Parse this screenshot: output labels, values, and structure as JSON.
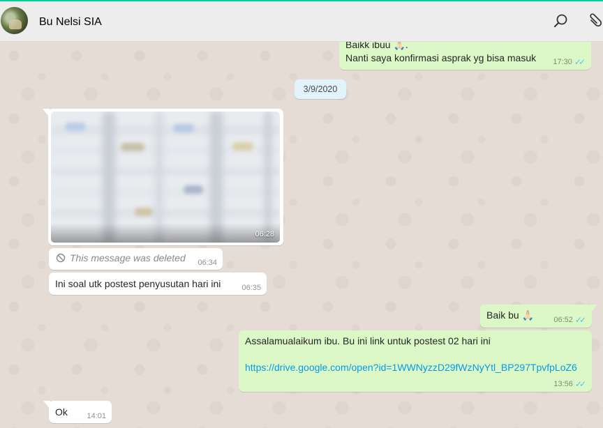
{
  "header": {
    "contact_name": "Bu Nelsi SIA",
    "icons": [
      "avatar",
      "search-icon",
      "paperclip-icon"
    ]
  },
  "colors": {
    "accent": "#06cf9c",
    "outgoing_bubble": "#dcf8c6",
    "incoming_bubble": "#ffffff",
    "date_chip": "#e1f3fb",
    "read_ticks": "#4fc3f7",
    "link": "#039be5",
    "chat_bg": "#e5ddd5"
  },
  "messages": {
    "m1": {
      "direction": "out",
      "line1": "Baikk ibuu 🙏🏻.",
      "line2": "Nanti saya konfirmasi asprak yg bisa masuk",
      "time": "17:30",
      "status": "read"
    },
    "date_separator": "3/9/2020",
    "m2": {
      "direction": "in",
      "type": "image",
      "time": "06:28"
    },
    "m3": {
      "direction": "in",
      "type": "deleted",
      "text": "This message was deleted",
      "time": "06:34"
    },
    "m4": {
      "direction": "in",
      "text": "Ini soal utk postest penyusutan hari ini",
      "time": "06:35"
    },
    "m5": {
      "direction": "out",
      "text": "Baik bu 🙏🏻",
      "time": "06:52",
      "status": "read"
    },
    "m6": {
      "direction": "out",
      "text": "Assalamualaikum ibu. Bu ini link untuk postest 02 hari ini",
      "link": "https://drive.google.com/open?id=1WWNyzzD29fWzNyYtl_BP297TpvfpLoZ6",
      "time": "13:56",
      "status": "read"
    },
    "m7": {
      "direction": "in",
      "text": "Ok",
      "time": "14:01"
    }
  }
}
